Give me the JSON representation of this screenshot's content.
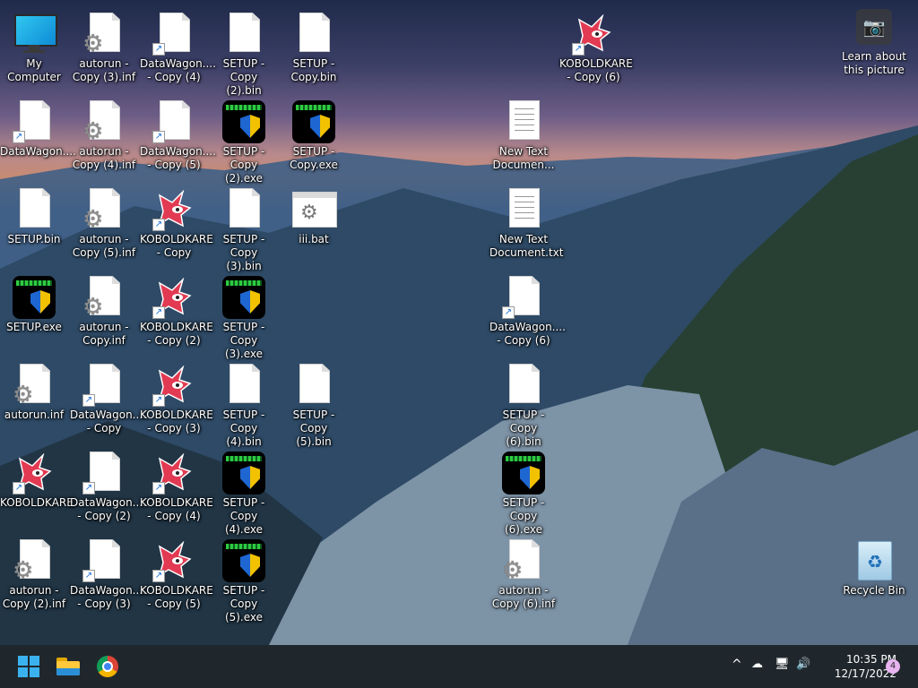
{
  "desktop": {
    "icons": [
      {
        "label": "My Computer",
        "type": "pc"
      },
      {
        "label": "autorun -\nCopy (3).inf",
        "type": "inf"
      },
      {
        "label": "DataWagon....\n- Copy (4)",
        "type": "shortcut"
      },
      {
        "label": "SETUP - Copy\n(2).bin",
        "type": "bin"
      },
      {
        "label": "SETUP -\nCopy.bin",
        "type": "bin"
      },
      {
        "label": "KOBOLDKARE\n- Copy (6)",
        "type": "kobold"
      },
      {
        "label": "DataWagon....",
        "type": "shortcut"
      },
      {
        "label": "autorun -\nCopy (4).inf",
        "type": "inf"
      },
      {
        "label": "DataWagon....\n- Copy (5)",
        "type": "shortcut"
      },
      {
        "label": "SETUP - Copy\n(2).exe",
        "type": "exe"
      },
      {
        "label": "SETUP -\nCopy.exe",
        "type": "exe"
      },
      {
        "label": "New Text\nDocumen...",
        "type": "txt"
      },
      {
        "label": "SETUP.bin",
        "type": "bin"
      },
      {
        "label": "autorun -\nCopy (5).inf",
        "type": "inf"
      },
      {
        "label": "KOBOLDKARE\n- Copy",
        "type": "kobold"
      },
      {
        "label": "SETUP - Copy\n(3).bin",
        "type": "bin"
      },
      {
        "label": "iii.bat",
        "type": "bat"
      },
      {
        "label": "New Text\nDocument.txt",
        "type": "txt"
      },
      {
        "label": "SETUP.exe",
        "type": "exe"
      },
      {
        "label": "autorun -\nCopy.inf",
        "type": "inf"
      },
      {
        "label": "KOBOLDKARE\n- Copy (2)",
        "type": "kobold"
      },
      {
        "label": "SETUP - Copy\n(3).exe",
        "type": "exe"
      },
      {
        "label": "DataWagon....\n- Copy (6)",
        "type": "shortcut"
      },
      {
        "label": "autorun.inf",
        "type": "inf"
      },
      {
        "label": "DataWagon....\n- Copy",
        "type": "shortcut"
      },
      {
        "label": "KOBOLDKARE\n- Copy (3)",
        "type": "kobold"
      },
      {
        "label": "SETUP - Copy\n(4).bin",
        "type": "bin"
      },
      {
        "label": "SETUP - Copy\n(5).bin",
        "type": "bin"
      },
      {
        "label": "SETUP - Copy\n(6).bin",
        "type": "bin"
      },
      {
        "label": "KOBOLDKARE",
        "type": "kobold"
      },
      {
        "label": "DataWagon....\n- Copy (2)",
        "type": "shortcut"
      },
      {
        "label": "KOBOLDKARE\n- Copy (4)",
        "type": "kobold"
      },
      {
        "label": "SETUP - Copy\n(4).exe",
        "type": "exe"
      },
      {
        "label": "SETUP - Copy\n(6).exe",
        "type": "exe"
      },
      {
        "label": "autorun -\nCopy (2).inf",
        "type": "inf"
      },
      {
        "label": "DataWagon....\n- Copy (3)",
        "type": "shortcut"
      },
      {
        "label": "KOBOLDKARE\n- Copy (5)",
        "type": "kobold"
      },
      {
        "label": "SETUP - Copy\n(5).exe",
        "type": "exe"
      },
      {
        "label": "autorun -\nCopy (6).inf",
        "type": "inf"
      },
      {
        "label": "Recycle Bin",
        "type": "recycle"
      }
    ],
    "learn_about": {
      "label": "Learn about\nthis picture",
      "icon": "camera-icon"
    }
  },
  "taskbar": {
    "apps": [
      {
        "name": "start",
        "icon": "windows-start-icon"
      },
      {
        "name": "file-explorer",
        "icon": "folder-icon"
      },
      {
        "name": "chrome",
        "icon": "chrome-icon"
      }
    ],
    "tray": {
      "chevron": "^",
      "time": "10:35 PM",
      "date": "12/17/2022",
      "notifications": "4"
    },
    "colors": {
      "background": "#20272c",
      "accent": "#3bb2f0"
    }
  }
}
